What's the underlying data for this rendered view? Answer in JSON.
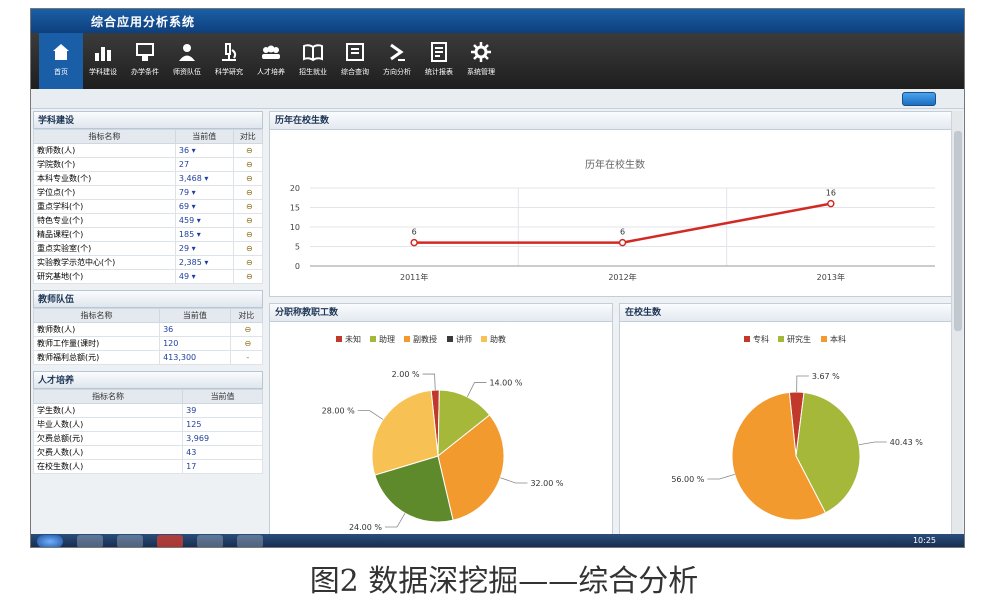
{
  "app": {
    "title": "综合应用分析系统"
  },
  "nav": {
    "items": [
      {
        "label": "首页",
        "icon": "home-icon"
      },
      {
        "label": "学科建设",
        "icon": "bar-chart-icon"
      },
      {
        "label": "办学条件",
        "icon": "building-icon"
      },
      {
        "label": "师资队伍",
        "icon": "people-icon"
      },
      {
        "label": "科学研究",
        "icon": "microscope-icon"
      },
      {
        "label": "人才培养",
        "icon": "group-icon"
      },
      {
        "label": "招生就业",
        "icon": "book-icon"
      },
      {
        "label": "综合查询",
        "icon": "search-form-icon"
      },
      {
        "label": "方向分析",
        "icon": "chevron-right-icon"
      },
      {
        "label": "统计报表",
        "icon": "report-icon"
      },
      {
        "label": "系统管理",
        "icon": "gear-icon"
      }
    ]
  },
  "left": {
    "discipline": {
      "title": "学科建设",
      "headers": [
        "指标名称",
        "当前值",
        "对比"
      ],
      "rows": [
        [
          "教师数(人)",
          "36 ▾",
          "⊖"
        ],
        [
          "学院数(个)",
          "27",
          "⊖"
        ],
        [
          "本科专业数(个)",
          "3,468 ▾",
          "⊖"
        ],
        [
          "学位点(个)",
          "79 ▾",
          "⊖"
        ],
        [
          "重点学科(个)",
          "69 ▾",
          "⊖"
        ],
        [
          "特色专业(个)",
          "459 ▾",
          "⊖"
        ],
        [
          "精品课程(个)",
          "185 ▾",
          "⊖"
        ],
        [
          "重点实验室(个)",
          "29 ▾",
          "⊖"
        ],
        [
          "实验教学示范中心(个)",
          "2,385 ▾",
          "⊖"
        ],
        [
          "研究基地(个)",
          "49 ▾",
          "⊖"
        ]
      ]
    },
    "faculty": {
      "title": "教师队伍",
      "headers": [
        "指标名称",
        "当前值",
        "对比"
      ],
      "rows": [
        [
          "教师数(人)",
          "36",
          "⊖"
        ],
        [
          "教师工作量(课时)",
          "120",
          "⊖"
        ],
        [
          "教师福利总额(元)",
          "413,300",
          "-"
        ]
      ]
    },
    "talent": {
      "title": "人才培养",
      "headers": [
        "指标名称",
        "当前值"
      ],
      "rows": [
        [
          "学生数(人)",
          "39"
        ],
        [
          "毕业人数(人)",
          "125"
        ],
        [
          "欠费总额(元)",
          "3,969"
        ],
        [
          "欠费人数(人)",
          "43"
        ],
        [
          "在校生数(人)",
          "17"
        ]
      ]
    }
  },
  "trend": {
    "panel_title": "历年在校生数"
  },
  "pie1": {
    "panel_title": "分职称教职工数"
  },
  "pie2": {
    "panel_title": "在校生数"
  },
  "taskbar": {
    "clock": "10:25"
  },
  "caption": "图2 数据深挖掘——综合分析",
  "chart_data": [
    {
      "type": "line",
      "title": "历年在校生数",
      "categories": [
        "2011年",
        "2012年",
        "2013年"
      ],
      "series": [
        {
          "values": [
            6,
            6,
            16
          ],
          "color": "#d22a23"
        }
      ],
      "ylim": [
        0,
        20
      ],
      "yticks": [
        0,
        5,
        10,
        15,
        20
      ],
      "data_labels": [
        "6",
        "6",
        "16"
      ],
      "grid": true
    },
    {
      "type": "pie",
      "legend_position": "top",
      "slices": [
        {
          "name": "未知",
          "value": 2.0,
          "label": "2.00 %",
          "color": "#c0392b"
        },
        {
          "name": "助理",
          "value": 14.0,
          "label": "14.00 %",
          "color": "#a5b83a"
        },
        {
          "name": "副教授",
          "value": 32.0,
          "label": "32.00 %",
          "color": "#f29a2e"
        },
        {
          "name": "讲师",
          "value": 24.0,
          "label": "24.00 %",
          "color": "#5e8a2b"
        },
        {
          "name": "助教",
          "value": 28.0,
          "label": "28.00 %",
          "color": "#f8c154"
        }
      ],
      "legend_colors": {
        "讲师": "#3a3a3a"
      }
    },
    {
      "type": "pie",
      "legend_position": "top",
      "slices": [
        {
          "name": "专科",
          "value": 3.67,
          "label": "3.67 %",
          "color": "#c0392b"
        },
        {
          "name": "研究生",
          "value": 40.43,
          "label": "40.43 %",
          "color": "#a5b83a"
        },
        {
          "name": "本科",
          "value": 56.0,
          "label": "56.00 %",
          "color": "#f29a2e"
        }
      ]
    }
  ]
}
